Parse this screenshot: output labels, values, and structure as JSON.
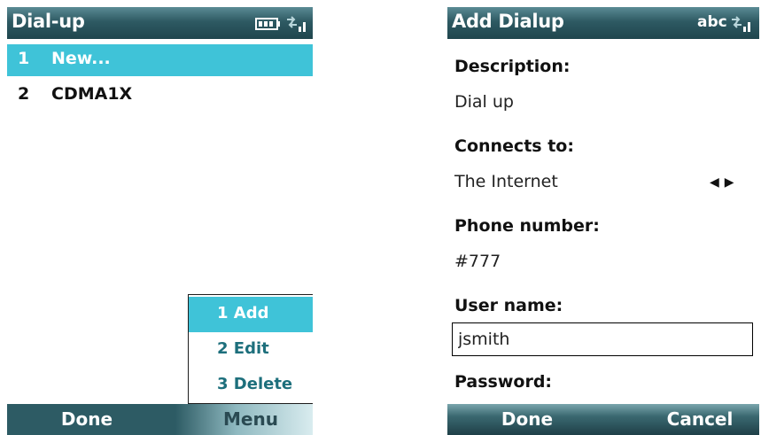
{
  "left_screen": {
    "title": "Dial-up",
    "list": [
      {
        "num": "1",
        "label": "New...",
        "selected": true
      },
      {
        "num": "2",
        "label": "CDMA1X",
        "selected": false
      }
    ],
    "menu_popup": [
      {
        "label": "1 Add",
        "selected": true
      },
      {
        "label": "2 Edit",
        "selected": false
      },
      {
        "label": "3 Delete",
        "selected": false
      }
    ],
    "softkeys": {
      "left": "Done",
      "right": "Menu"
    }
  },
  "right_screen": {
    "title": "Add Dialup",
    "input_mode": "abc",
    "fields": {
      "description_label": "Description:",
      "description_value": "Dial up",
      "connects_label": "Connects to:",
      "connects_value": "The Internet",
      "phone_label": "Phone number:",
      "phone_value": "#777",
      "user_label": "User name:",
      "user_value": "jsmith",
      "password_label": "Password:"
    },
    "softkeys": {
      "left": "Done",
      "right": "Cancel"
    }
  },
  "icons": {
    "battery": "battery-icon",
    "signal": "signal-data-icon",
    "left_right_arrows": "left-right-arrows-icon"
  },
  "colors": {
    "accent": "#3fc3d8",
    "titlebar": "#2e5a63",
    "menu_text": "#1d6f7c"
  }
}
